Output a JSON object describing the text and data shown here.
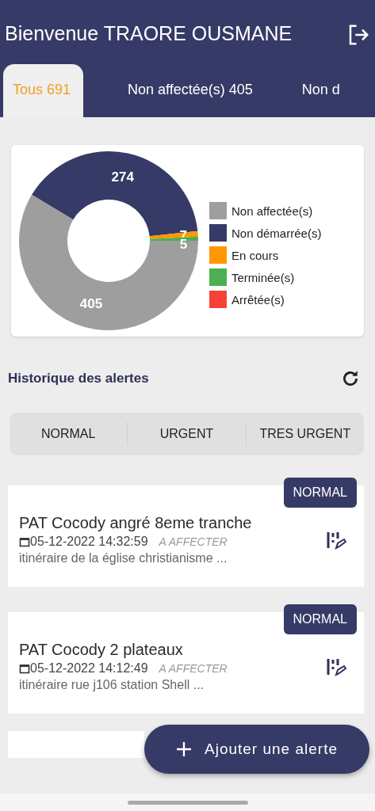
{
  "header": {
    "title": "Bienvenue TRAORE OUSMANE"
  },
  "tabs": [
    {
      "label": "Tous 691",
      "selected": true
    },
    {
      "label": "Non affectée(s)  405",
      "selected": false
    },
    {
      "label": "Non d",
      "selected": false
    }
  ],
  "summary_chart": {
    "chart_data": {
      "type": "donut",
      "categories": [
        "Non affectée(s)",
        "Non démarrée(s)",
        "En cours",
        "Terminée(s)",
        "Arrêtée(s)"
      ],
      "values": [
        405,
        274,
        7,
        5,
        0
      ],
      "colors": [
        "#9e9e9e",
        "#363a66",
        "#ff9800",
        "#4caf50",
        "#f44336"
      ],
      "data_labels": true,
      "legend": true
    }
  },
  "history": {
    "title": "Historique des alertes"
  },
  "filters": [
    {
      "label": "NORMAL",
      "selected": false
    },
    {
      "label": "URGENT",
      "selected": false
    },
    {
      "label": "TRES URGENT",
      "selected": false
    }
  ],
  "alerts": [
    {
      "kind": "full",
      "priority": "NORMAL",
      "title": "PAT  Cocody angré 8eme tranche",
      "date": "05-12-2022 14:32:59",
      "status": "A AFFECTER",
      "description": "itinéraire de la église christianisme ..."
    },
    {
      "kind": "full",
      "priority": "NORMAL",
      "title": "PAT Cocody 2 plateaux",
      "date": "05-12-2022 14:12:49",
      "status": "A AFFECTER",
      "description": "itinéraire rue j106 station Shell ..."
    },
    {
      "kind": "partial"
    }
  ],
  "fab": {
    "label": "Ajouter une alerte"
  }
}
